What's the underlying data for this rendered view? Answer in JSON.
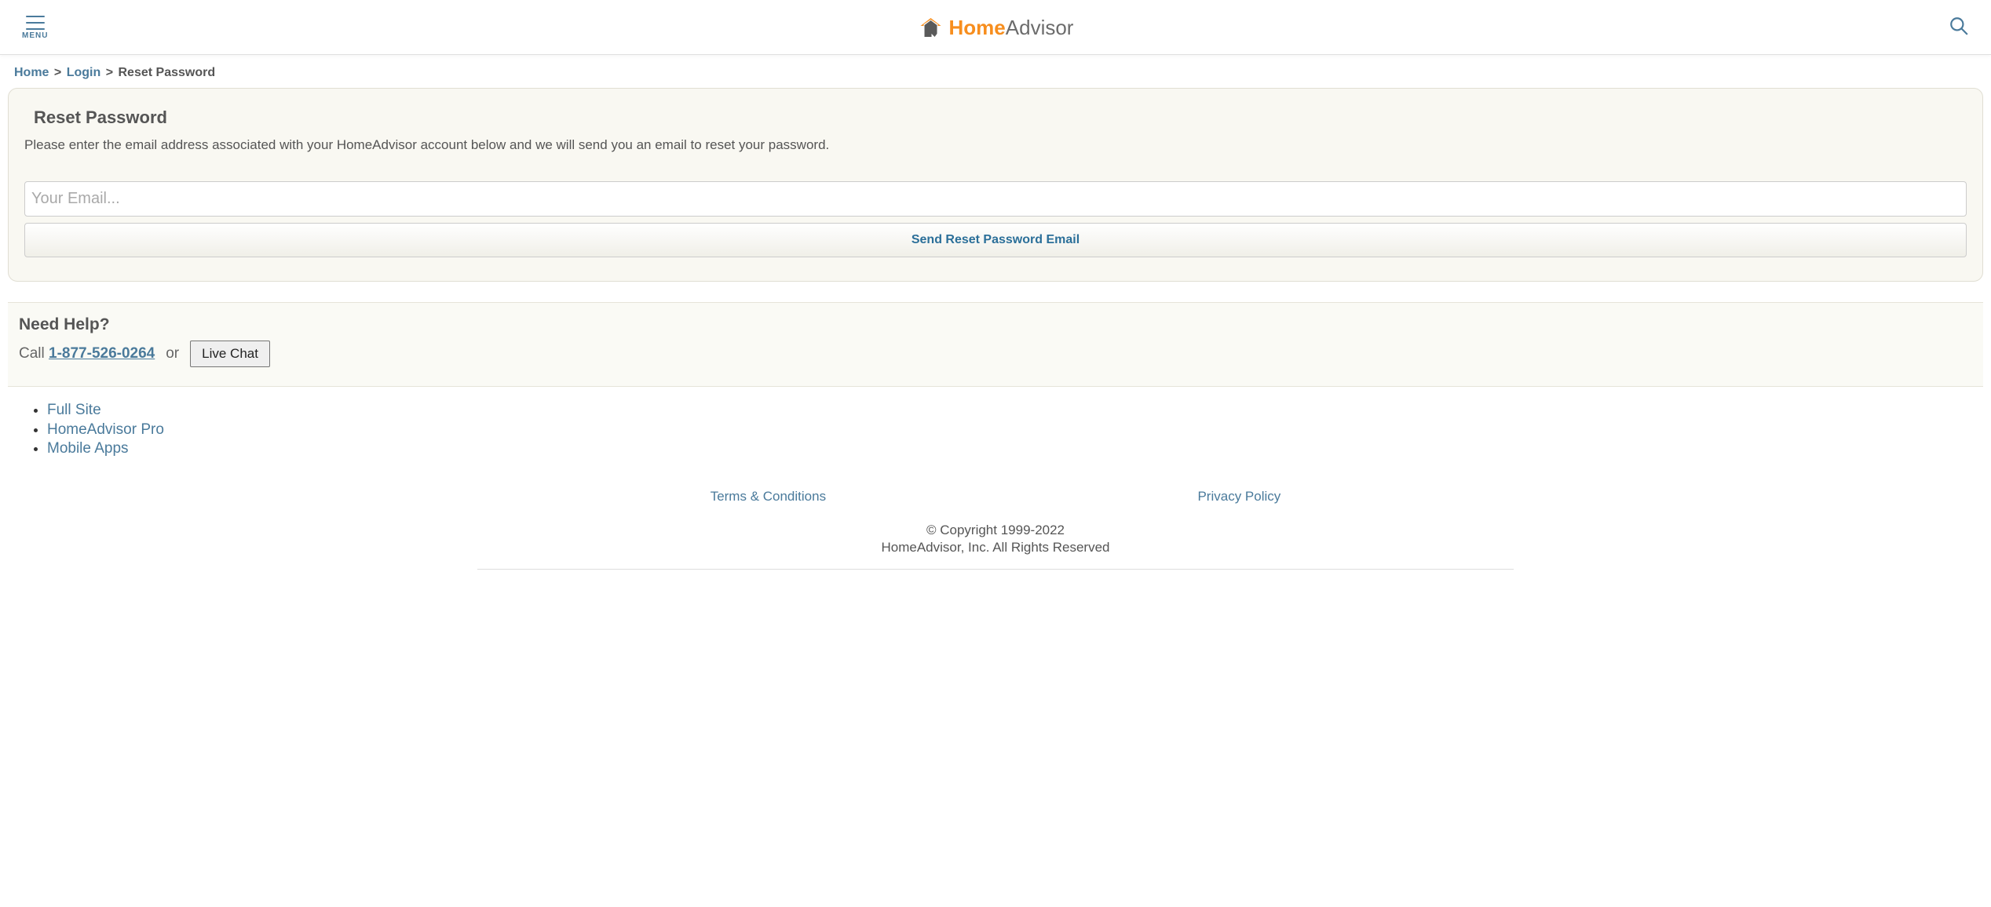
{
  "header": {
    "menu_label": "MENU",
    "logo_home": "Home",
    "logo_advisor": "Advisor"
  },
  "breadcrumb": {
    "home": "Home",
    "login": "Login",
    "current": "Reset Password"
  },
  "main": {
    "title": "Reset Password",
    "instruction": "Please enter the email address associated with your HomeAdvisor account below and we will send you an email to reset your password.",
    "email_placeholder": "Your Email...",
    "submit_label": "Send Reset Password Email"
  },
  "help": {
    "title": "Need Help?",
    "call_prefix": "Call ",
    "phone": "1-877-526-0264",
    "or": "or",
    "chat_label": "Live Chat"
  },
  "footer": {
    "links": {
      "full_site": "Full Site",
      "pro": "HomeAdvisor Pro",
      "mobile": "Mobile Apps"
    },
    "terms": "Terms & Conditions",
    "privacy": "Privacy Policy",
    "copyright_line1": "© Copyright 1999-2022",
    "copyright_line2": "HomeAdvisor, Inc. All Rights Reserved"
  }
}
